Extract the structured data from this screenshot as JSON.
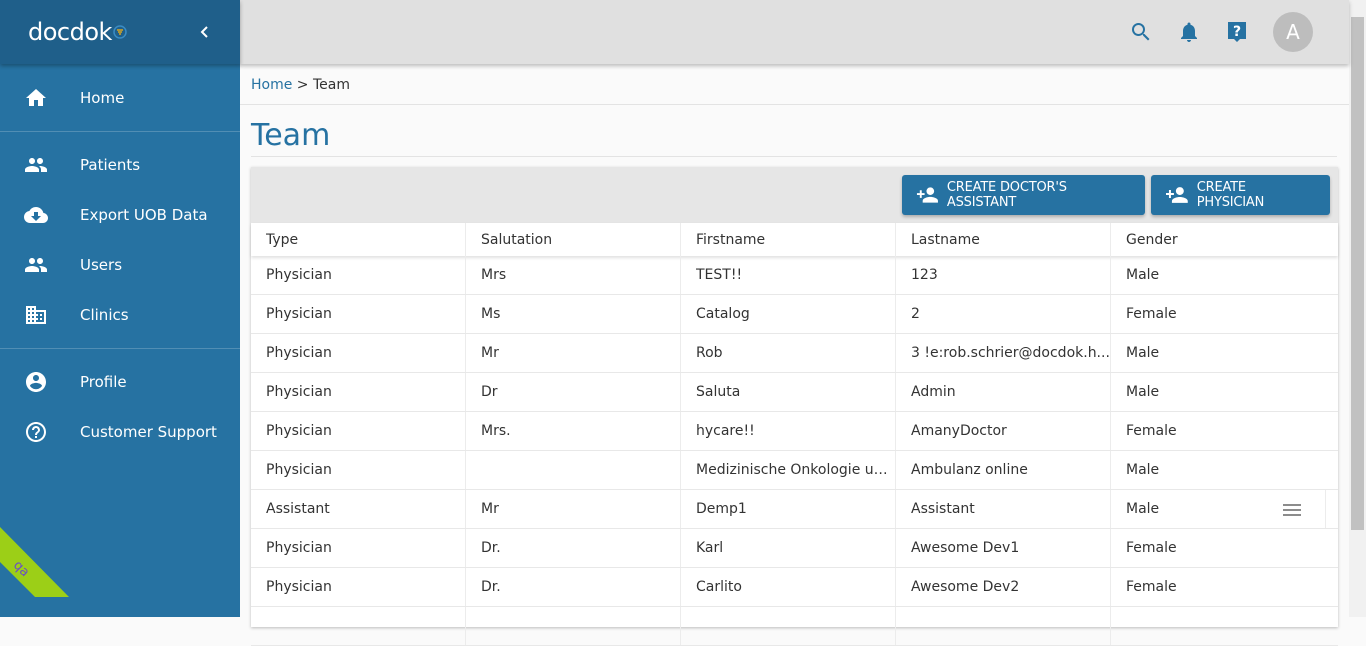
{
  "app": {
    "logo": "docdok",
    "env_badge": "qa"
  },
  "sidebar": {
    "items": [
      {
        "label": "Home",
        "icon": "home-icon"
      },
      {
        "label": "Patients",
        "icon": "people-icon"
      },
      {
        "label": "Export UOB Data",
        "icon": "cloud-download-icon"
      },
      {
        "label": "Users",
        "icon": "people-icon"
      },
      {
        "label": "Clinics",
        "icon": "building-icon"
      },
      {
        "label": "Profile",
        "icon": "account-circle-icon"
      },
      {
        "label": "Customer Support",
        "icon": "help-circle-icon"
      }
    ]
  },
  "topbar": {
    "avatar_initial": "A"
  },
  "breadcrumb": {
    "home": "Home",
    "sep": " > ",
    "current": "Team"
  },
  "page": {
    "title": "Team"
  },
  "toolbar": {
    "create_assistant": "CREATE DOCTOR'S ASSISTANT",
    "create_physician": "CREATE PHYSICIAN"
  },
  "table": {
    "columns": [
      "Type",
      "Salutation",
      "Firstname",
      "Lastname",
      "Gender"
    ],
    "rows": [
      [
        "Physician",
        "Mrs",
        "TEST!!",
        "123",
        "Male"
      ],
      [
        "Physician",
        "Ms",
        "Catalog",
        "2",
        "Female"
      ],
      [
        "Physician",
        "Mr",
        "Rob",
        "3 !e:rob.schrier@docdok.h...",
        "Male"
      ],
      [
        "Physician",
        "Dr",
        "Saluta",
        "Admin",
        "Male"
      ],
      [
        "Physician",
        "Mrs.",
        "hycare!!",
        "AmanyDoctor",
        "Female"
      ],
      [
        "Physician",
        "",
        "Medizinische Onkologie un...",
        "Ambulanz online",
        "Male"
      ],
      [
        "Assistant",
        "Mr",
        "Demp1",
        "Assistant",
        "Male"
      ],
      [
        "Physician",
        "Dr.",
        "Karl",
        "Awesome Dev1",
        "Female"
      ],
      [
        "Physician",
        "Dr.",
        "Carlito",
        "Awesome Dev2",
        "Female"
      ],
      [
        "",
        "",
        "",
        "",
        ""
      ]
    ],
    "hovered_row_index": 6
  },
  "colors": {
    "primary": "#2672a2",
    "header": "#1f5f8a",
    "badge": "#9ccf17"
  }
}
